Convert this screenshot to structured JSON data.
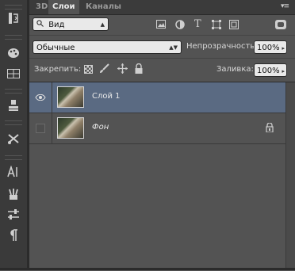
{
  "tabs": [
    {
      "label": "3D",
      "active": false
    },
    {
      "label": "Слои",
      "active": true
    },
    {
      "label": "Каналы",
      "active": false
    }
  ],
  "filter": {
    "kind_label": "Вид"
  },
  "blend": {
    "mode": "Обычные",
    "opacity_label": "Непрозрачность:",
    "opacity_value": "100%"
  },
  "lock": {
    "label": "Закрепить:",
    "fill_label": "Заливка:",
    "fill_value": "100%"
  },
  "layers": [
    {
      "name": "Слой 1",
      "visible": true,
      "selected": true,
      "locked": false
    },
    {
      "name": "Фон",
      "visible": false,
      "selected": false,
      "locked": true
    }
  ],
  "colors": {
    "selected_row": "#5a6a82",
    "panel": "#535353",
    "toolstrip": "#3a3a3a"
  }
}
